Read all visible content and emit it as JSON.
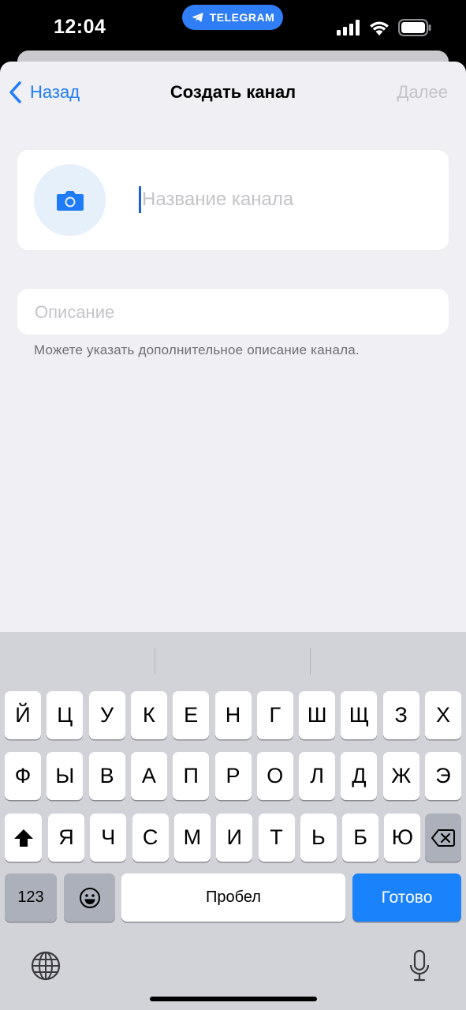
{
  "status_bar": {
    "time": "12:04",
    "app_pill": "TELEGRAM",
    "icons": [
      "signal-icon",
      "wifi-icon",
      "battery-icon"
    ]
  },
  "nav": {
    "back_label": "Назад",
    "title": "Создать канал",
    "next_label": "Далее"
  },
  "channel_form": {
    "avatar_icon": "camera-icon",
    "name_placeholder": "Название канала",
    "description_placeholder": "Описание",
    "description_hint": "Можете указать дополнительное описание канала."
  },
  "keyboard": {
    "row1": [
      "Й",
      "Ц",
      "У",
      "К",
      "Е",
      "Н",
      "Г",
      "Ш",
      "Щ",
      "З",
      "Х"
    ],
    "row2": [
      "Ф",
      "Ы",
      "В",
      "А",
      "П",
      "Р",
      "О",
      "Л",
      "Д",
      "Ж",
      "Э"
    ],
    "row3": [
      "Я",
      "Ч",
      "С",
      "М",
      "И",
      "Т",
      "Ь",
      "Б",
      "Ю"
    ],
    "numbers_label": "123",
    "space_label": "Пробел",
    "done_label": "Готово",
    "icons": [
      "shift-icon",
      "backspace-icon",
      "emoji-icon",
      "globe-icon",
      "microphone-icon"
    ]
  },
  "colors": {
    "accent": "#1f7cf6",
    "placeholder": "#c4c4c8",
    "background": "#efeff4",
    "keyboard_bg": "#d1d3d9"
  }
}
